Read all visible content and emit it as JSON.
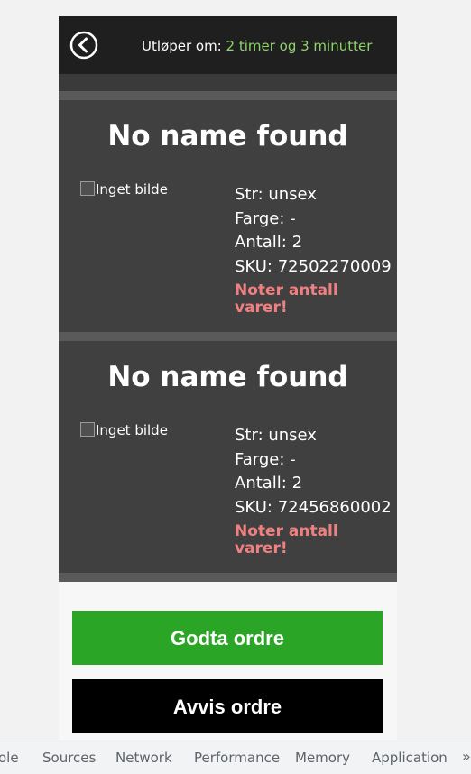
{
  "header": {
    "expires_label": "Utløper om:",
    "expires_value": "2 timer og 3 minutter",
    "back_icon": "back-arrow-circle-icon"
  },
  "items": [
    {
      "title": "No name found",
      "image_alt": "Inget bilde",
      "size": "Str: unsex",
      "color": "Farge: -",
      "quantity": "Antall: 2",
      "sku": "SKU: 72502270009",
      "note": "Noter antall varer!"
    },
    {
      "title": "No name found",
      "image_alt": "Inget bilde",
      "size": "Str: unsex",
      "color": "Farge: -",
      "quantity": "Antall: 2",
      "sku": "SKU: 72456860002",
      "note": "Noter antall varer!"
    }
  ],
  "actions": {
    "accept_label": "Godta ordre",
    "reject_label": "Avvis ordre"
  },
  "devtools": {
    "tabs": [
      "ole",
      "Sources",
      "Network",
      "Performance",
      "Memory",
      "Application"
    ],
    "more": "»"
  },
  "colors": {
    "accent_green": "#2aa526",
    "time_green": "#8fd36b",
    "note_red": "#f08080",
    "card_bg": "#404040"
  }
}
